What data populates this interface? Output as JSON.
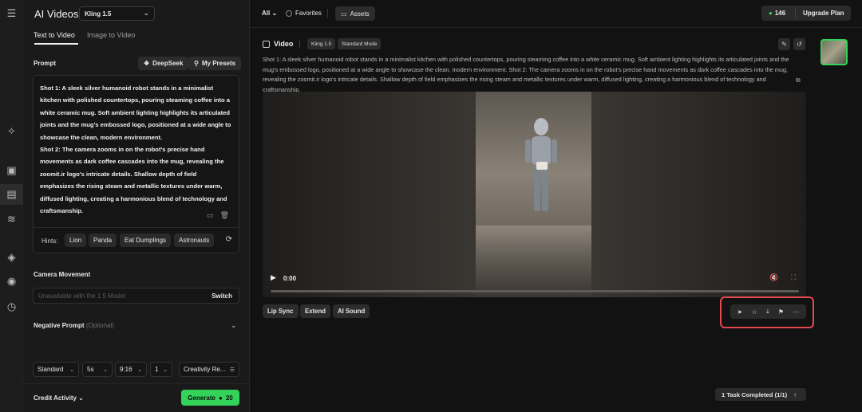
{
  "app": {
    "title": "AI Videos",
    "model": "Kling 1.5"
  },
  "tabs": [
    {
      "label": "Text to Video",
      "active": true
    },
    {
      "label": "Image to Video",
      "active": false
    }
  ],
  "prompt": {
    "label": "Prompt",
    "deepseek_label": "DeepSeek",
    "presets_label": "My Presets",
    "text": "Shot 1: A sleek silver humanoid robot stands in a minimalist kitchen with polished countertops, pouring steaming coffee into a white ceramic mug. Soft ambient lighting highlights its articulated joints and the mug's embossed logo, positioned at a wide angle to showcase the clean, modern environment.\nShot 2: The camera zooms in on the robot's precise hand movements as dark coffee cascades into the mug, revealing the zoomit.ir logo's intricate details. Shallow depth of field emphasizes the rising steam and metallic textures under warm, diffused lighting, creating a harmonious blend of technology and craftsmanship."
  },
  "hints": {
    "label": "Hints:",
    "items": [
      "Lion",
      "Panda",
      "Eat Dumplings",
      "Astronauts"
    ]
  },
  "camera": {
    "label": "Camera Movement",
    "placeholder": "Unavailable with the 1.5 Model",
    "switch_label": "Switch"
  },
  "negative": {
    "label": "Negative Prompt",
    "optional": "(Optional)"
  },
  "settings": {
    "mode": "Standard",
    "duration": "5s",
    "ratio": "9:16",
    "count": "1",
    "creativity": "Creativity Re..."
  },
  "footer": {
    "credit_label": "Credit Activity",
    "generate_label": "Generate",
    "generate_cost": "20"
  },
  "topbar": {
    "all_label": "All",
    "favorites_label": "Favorites",
    "assets_label": "Assets",
    "credits": "146",
    "upgrade_label": "Upgrade Plan"
  },
  "video": {
    "title": "Video",
    "model_tag": "Kling 1.5",
    "mode_tag": "Standard Mode",
    "description": "Shot 1: A sleek silver humanoid robot stands in a minimalist kitchen with polished countertops, pouring steaming coffee into a white ceramic mug. Soft ambient lighting highlights its articulated joints and the mug's embossed logo, positioned at a wide angle to showcase the clean, modern environment. Shot 2: The camera zooms in on the robot's precise hand movements as dark coffee cascades into the mug, revealing the zoomit.ir logo's intricate details. Shallow depth of field emphasizes the rising steam and metallic textures under warm, diffused lighting, creating a harmonious blend of technology and craftsmanship.",
    "time": "0:00",
    "progress": 0
  },
  "actions": [
    "Lip Sync",
    "Extend",
    "AI Sound"
  ],
  "tools": [
    "send-icon",
    "star-icon",
    "download-icon",
    "flag-icon",
    "more-icon"
  ],
  "task": {
    "status": "1 Task Completed",
    "count": "(1/1)"
  },
  "colors": {
    "accent": "#33d35a",
    "highlight": "#e3474f"
  }
}
